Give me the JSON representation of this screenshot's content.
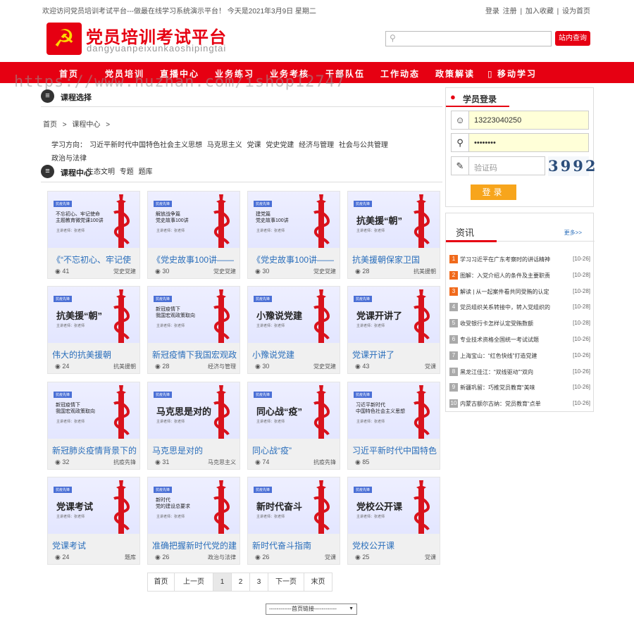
{
  "topbar": {
    "welcome": "欢迎访问党员培训考试平台---做最在线学习系统演示平台！ 今天是2021年3月9日 星期二",
    "login": "登录",
    "register": "注册",
    "sep": "|",
    "favorite": "加入收藏",
    "homepage": "设为首页"
  },
  "header": {
    "title": "党员培训考试平台",
    "pinyin": "dangyuanpeixunkaoshipingtai",
    "emblem": "☭",
    "search_placeholder": "",
    "search_button": "站内查询"
  },
  "nav": [
    "首页",
    "党员培训",
    "直播中心",
    "业务练习",
    "业务考核",
    "干部队伍",
    "工作动态",
    "政策解读",
    "移动学习"
  ],
  "watermark": "https://www.huzhan.com/ishop12747",
  "sections": {
    "course_select": "课程选择",
    "course_center": "课程中心"
  },
  "breadcrumb": [
    "首页",
    ">",
    "课程中心",
    ">"
  ],
  "filter": {
    "label": "学习方向：",
    "items_row1": [
      "习近平新时代中国特色社会主义思想",
      "马克思主义",
      "党课",
      "党史党建",
      "经济与管理",
      "社会与公共管理",
      "政治与法律"
    ],
    "items_row2": [
      "生态文明",
      "专题",
      "题库"
    ]
  },
  "courses": [
    {
      "thumb_lines": [
        "不忘初心、牢记使命",
        "主题教育微党课100讲"
      ],
      "thumb_big": "",
      "title": "《“不忘初心、牢记使",
      "views": "41",
      "category": "党史党建"
    },
    {
      "thumb_lines": [
        "解放战争篇",
        "党史故事100讲"
      ],
      "thumb_big": "",
      "title": "《党史故事100讲——",
      "views": "30",
      "category": "党史党建"
    },
    {
      "thumb_lines": [
        "建党篇",
        "党史故事100讲"
      ],
      "thumb_big": "",
      "title": "《党史故事100讲——",
      "views": "30",
      "category": "党史党建"
    },
    {
      "thumb_lines": [],
      "thumb_big": "抗美援“朝”",
      "title": "抗美援朝保家卫国",
      "views": "28",
      "category": "抗美援朝"
    },
    {
      "thumb_lines": [],
      "thumb_big": "抗美援“朝”",
      "title": "伟大的抗美援朝",
      "views": "24",
      "category": "抗美援朝"
    },
    {
      "thumb_lines": [
        "新冠疫情下",
        "我国宏观政策取向"
      ],
      "thumb_big": "",
      "title": "新冠疫情下我国宏观政",
      "views": "28",
      "category": "经济与管理"
    },
    {
      "thumb_lines": [],
      "thumb_big": "小豫说党建",
      "title": "小豫说党建",
      "views": "30",
      "category": "党史党建"
    },
    {
      "thumb_lines": [],
      "thumb_big": "党课开讲了",
      "title": "党课开讲了",
      "views": "43",
      "category": "党课"
    },
    {
      "thumb_lines": [
        "新冠疫情下",
        "我国宏观政策取向"
      ],
      "thumb_big": "",
      "title": "新冠肺炎疫情背景下的",
      "views": "32",
      "category": "抗疫先锋"
    },
    {
      "thumb_lines": [],
      "thumb_big": "马克思是对的",
      "title": "马克思是对的",
      "views": "31",
      "category": "马克思主义"
    },
    {
      "thumb_lines": [],
      "thumb_big": "同心战“疫”",
      "title": "同心战“疫”",
      "views": "74",
      "category": "抗疫先锋"
    },
    {
      "thumb_lines": [
        "习近平新时代",
        "中国特色社会主义思想"
      ],
      "thumb_big": "",
      "title": "习近平新时代中国特色",
      "views": "85",
      "category": ""
    },
    {
      "thumb_lines": [],
      "thumb_big": "党课考试",
      "title": "党课考试",
      "views": "24",
      "category": "题库"
    },
    {
      "thumb_lines": [
        "新时代",
        "党的建设总要求"
      ],
      "thumb_big": "",
      "title": "准确把握新时代党的建",
      "views": "26",
      "category": "政治与法律"
    },
    {
      "thumb_lines": [],
      "thumb_big": "新时代奋斗",
      "title": "新时代奋斗指南",
      "views": "26",
      "category": "党课"
    },
    {
      "thumb_lines": [],
      "thumb_big": "党校公开课",
      "title": "党校公开课",
      "views": "25",
      "category": "党课"
    }
  ],
  "thumb_tag": "抗疫先锋",
  "thumb_teacher": "主讲老师：张老师",
  "pager": {
    "first": "首页",
    "prev": "上一页",
    "pages": [
      "1",
      "2",
      "3"
    ],
    "next": "下一页",
    "last": "末页",
    "current": "1"
  },
  "friend_links": "------------首页链接------------",
  "login": {
    "title": "学员登录",
    "username": "13223040250",
    "password": "••••••••",
    "captcha_placeholder": "验证码",
    "captcha_code": "3992",
    "button": "登录"
  },
  "news": {
    "title": "资讯",
    "more": "更多>>",
    "items": [
      {
        "num": "1",
        "title": "学习习近平在广东考察时的讲话精神",
        "date": "[10-26]"
      },
      {
        "num": "2",
        "title": "图解：入党介绍人的条件及主要职责",
        "date": "[10-28]"
      },
      {
        "num": "3",
        "title": "解读 | 从一起案件看共同受贿的认定",
        "date": "[10-28]"
      },
      {
        "num": "4",
        "title": "党员组织关系转接中，转入党组织的",
        "date": "[10-28]"
      },
      {
        "num": "5",
        "title": "收受银行卡怎样认定受贿数额",
        "date": "[10-28]"
      },
      {
        "num": "6",
        "title": "专业技术资格全国统一考试试题",
        "date": "[10-26]"
      },
      {
        "num": "7",
        "title": "上海宝山：“红色快线”打造党建",
        "date": "[10-26]"
      },
      {
        "num": "8",
        "title": "黑龙江佳江：“双线驱动”“双向",
        "date": "[10-26]"
      },
      {
        "num": "9",
        "title": "新疆巩留：巧推党员教育“美味",
        "date": "[10-26]"
      },
      {
        "num": "10",
        "title": "内蒙古额尔古纳：党员教育“点单",
        "date": "[10-26]"
      }
    ]
  },
  "colors": {
    "brand_red": "#e60012",
    "link_blue": "#2a6ebb",
    "login_orange": "#f7a51c"
  }
}
